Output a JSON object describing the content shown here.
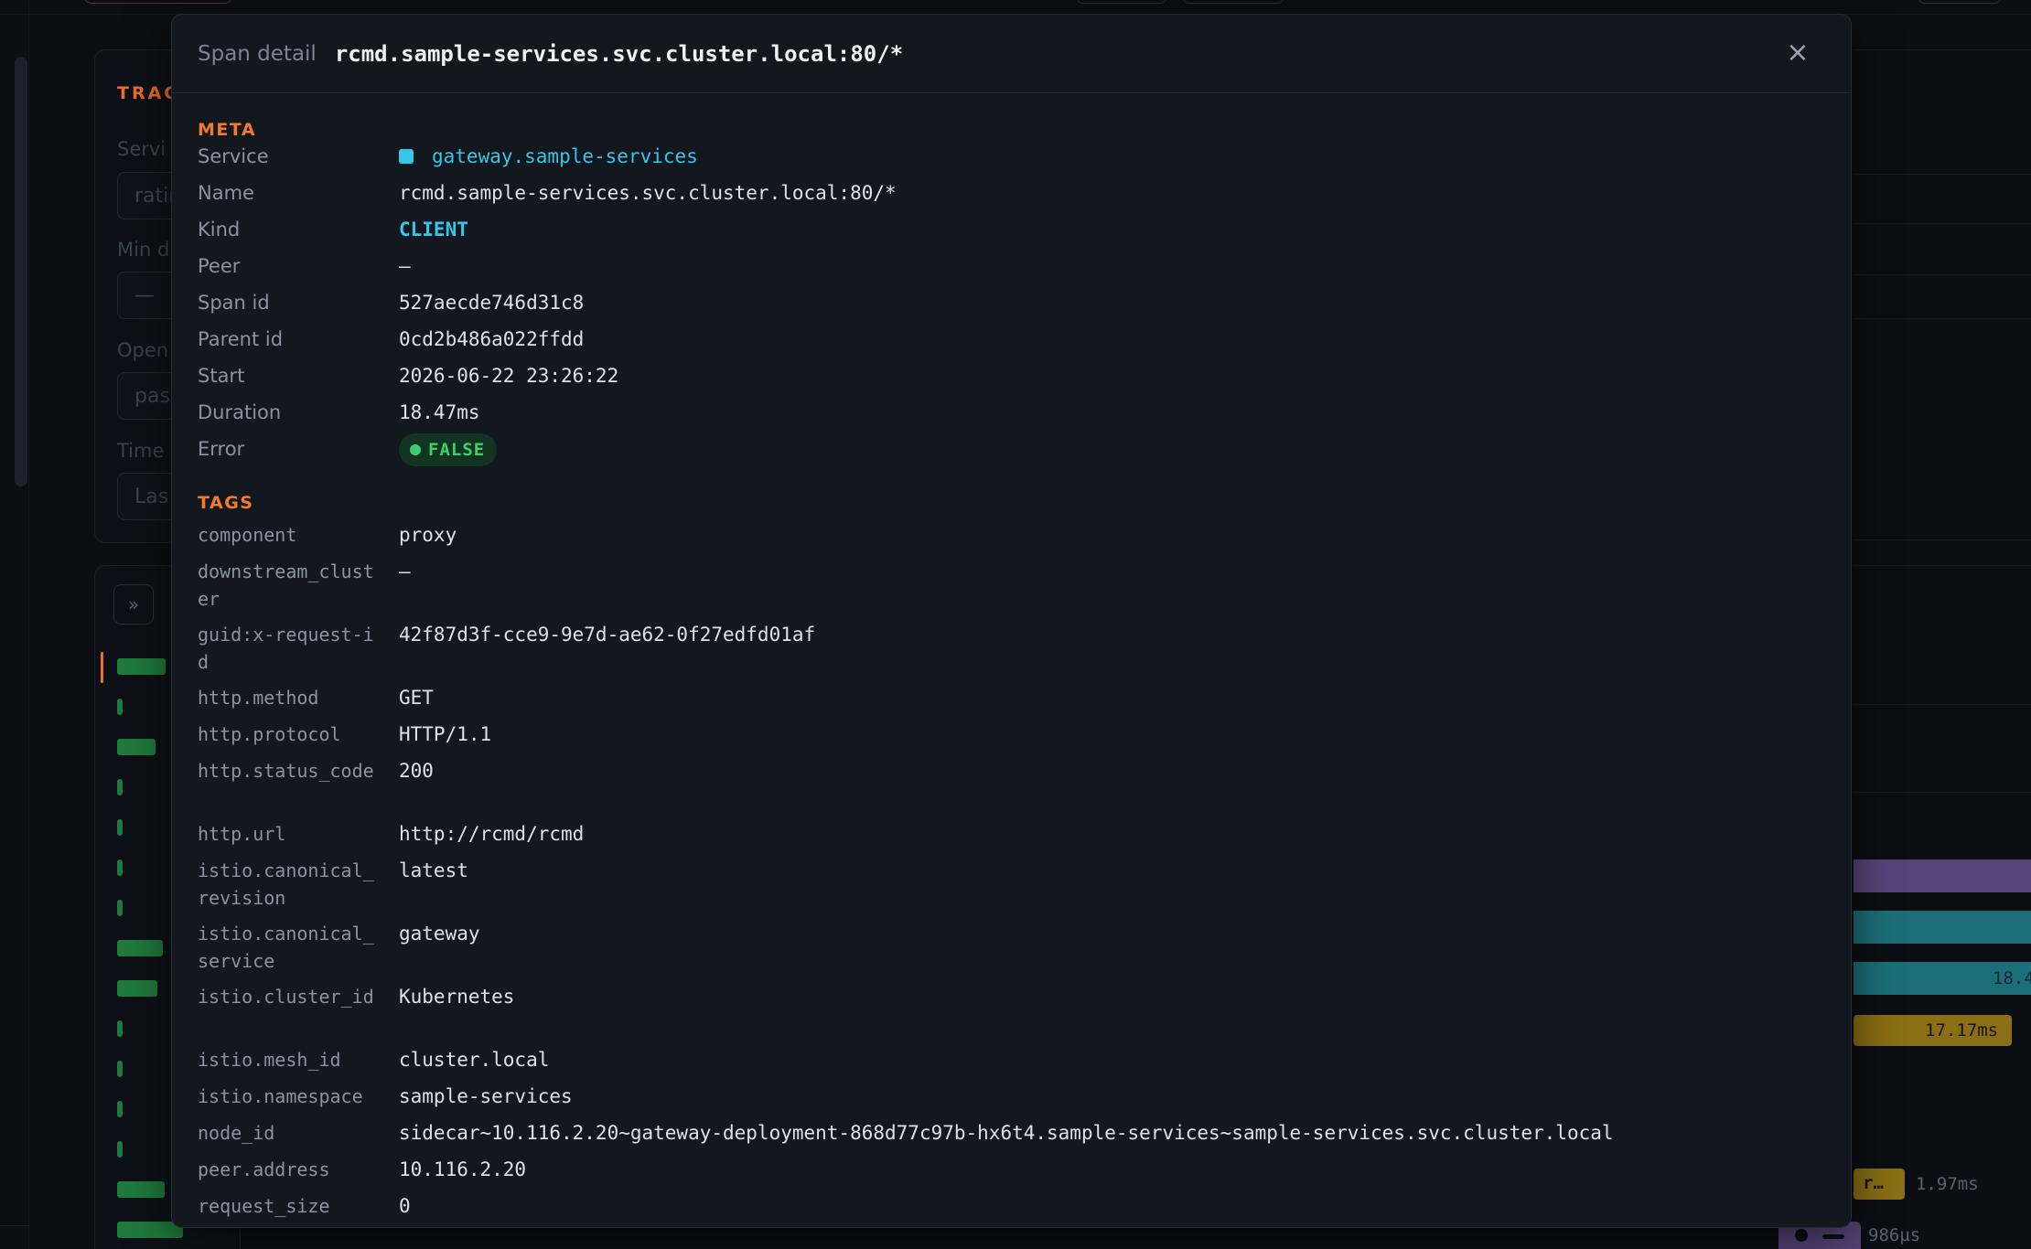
{
  "colors": {
    "accent": "#f07a32",
    "service": "#35c6e8",
    "success": "#3ccf6e",
    "bar_green": "#1f7a3d",
    "bar_purple": "#57457a",
    "bar_teal": "#1c6f78",
    "bar_yellow": "#8a6f14"
  },
  "background": {
    "trace_title": "TRAC",
    "labels": [
      "Servi",
      "Min d",
      "Open",
      "Time"
    ],
    "inputs": [
      "ratin",
      "—",
      "pas",
      "Las"
    ],
    "expand_icon": "»",
    "span_labels": {
      "teal_partial": "18.4",
      "yellow": "17.17ms",
      "small_box": "r…",
      "small_box_duration": "1.97ms",
      "bottom_duration": "986µs"
    }
  },
  "modal": {
    "label": "Span detail",
    "title": "rcmd.sample-services.svc.cluster.local:80/*",
    "close_icon": "×",
    "meta": {
      "section_title": "META",
      "service_label": "Service",
      "service_value": "gateway.sample-services",
      "name_label": "Name",
      "name_value": "rcmd.sample-services.svc.cluster.local:80/*",
      "kind_label": "Kind",
      "kind_value": "CLIENT",
      "peer_label": "Peer",
      "peer_value": "—",
      "span_id_label": "Span id",
      "span_id_value": "527aecde746d31c8",
      "parent_id_label": "Parent id",
      "parent_id_value": "0cd2b486a022ffdd",
      "start_label": "Start",
      "start_value": "2026-06-22 23:26:22",
      "duration_label": "Duration",
      "duration_value": "18.47ms",
      "error_label": "Error",
      "error_value": "FALSE"
    },
    "tags": {
      "section_title": "TAGS",
      "items": [
        {
          "key": "component",
          "value": "proxy"
        },
        {
          "key": "downstream_cluster",
          "value": "—"
        },
        {
          "key": "guid:x-request-id",
          "value": "42f87d3f-cce9-9e7d-ae62-0f27edfd01af"
        },
        {
          "key": "http.method",
          "value": "GET"
        },
        {
          "key": "http.protocol",
          "value": "HTTP/1.1"
        },
        {
          "key": "http.status_code",
          "value": "200"
        },
        {
          "key": "http.url",
          "value": "http://rcmd/rcmd"
        },
        {
          "key": "istio.canonical_revision",
          "value": "latest"
        },
        {
          "key": "istio.canonical_service",
          "value": "gateway"
        },
        {
          "key": "istio.cluster_id",
          "value": "Kubernetes"
        },
        {
          "key": "istio.mesh_id",
          "value": "cluster.local"
        },
        {
          "key": "istio.namespace",
          "value": "sample-services"
        },
        {
          "key": "node_id",
          "value": "sidecar~10.116.2.20~gateway-deployment-868d77c97b-hx6t4.sample-services~sample-services.svc.cluster.local"
        },
        {
          "key": "peer.address",
          "value": "10.116.2.20"
        },
        {
          "key": "request_size",
          "value": "0"
        }
      ]
    }
  }
}
